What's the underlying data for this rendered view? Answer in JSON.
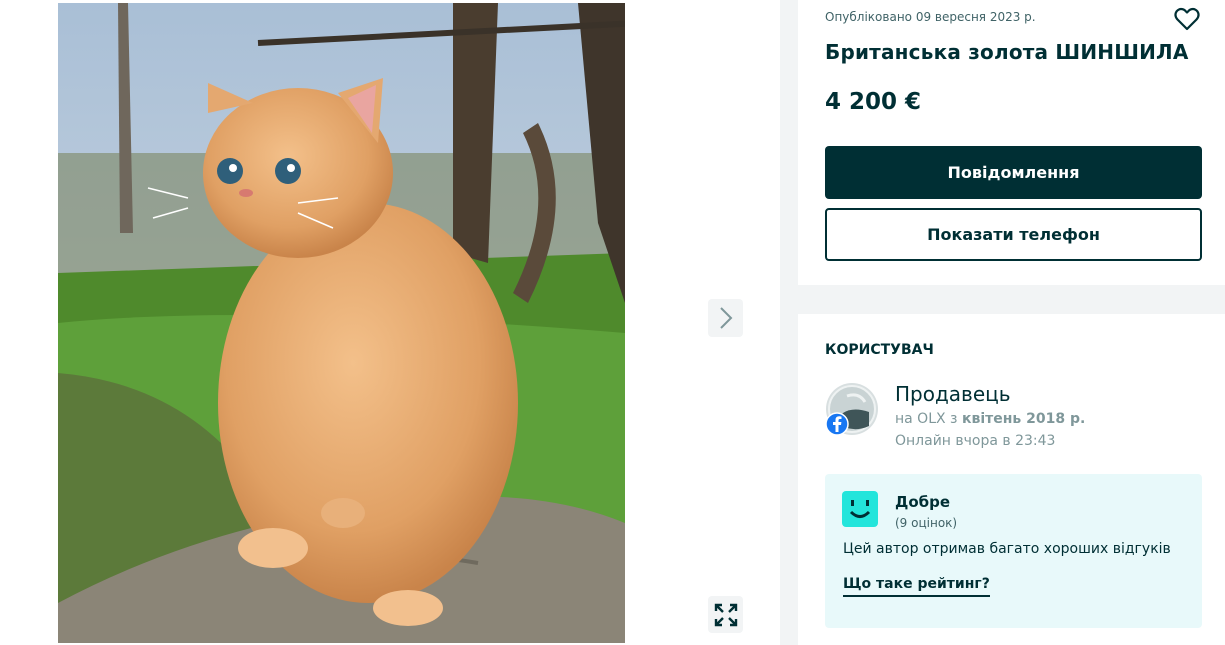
{
  "listing": {
    "published": "Опубліковано 09 вересня 2023 р.",
    "title": "Британська золота ШИНШИЛА",
    "price": "4 200 €",
    "message_button": "Повідомлення",
    "phone_button": "Показати телефон",
    "favorite_icon": "heart-icon"
  },
  "gallery": {
    "photo_alt": "Британська золота ШИНШИЛА",
    "next_icon": "chevron-right-icon",
    "expand_icon": "expand-icon"
  },
  "user": {
    "section_title": "КОРИСТУВАЧ",
    "name": "Продавець",
    "since_prefix": "на OLX з",
    "since_date": "квітень 2018 р.",
    "online": "Онлайн вчора в 23:43",
    "avatar_badge": "facebook-icon"
  },
  "rating": {
    "label": "Добре",
    "count": "(9 оцінок)",
    "description": "Цей автор отримав багато хороших відгуків",
    "link": "Що таке рейтинг?",
    "icon": "smile-icon"
  },
  "colors": {
    "primary": "#002f34",
    "rating_bg": "#e8f9fa",
    "smile": "#23e5db",
    "page_bg": "#f2f4f5"
  }
}
